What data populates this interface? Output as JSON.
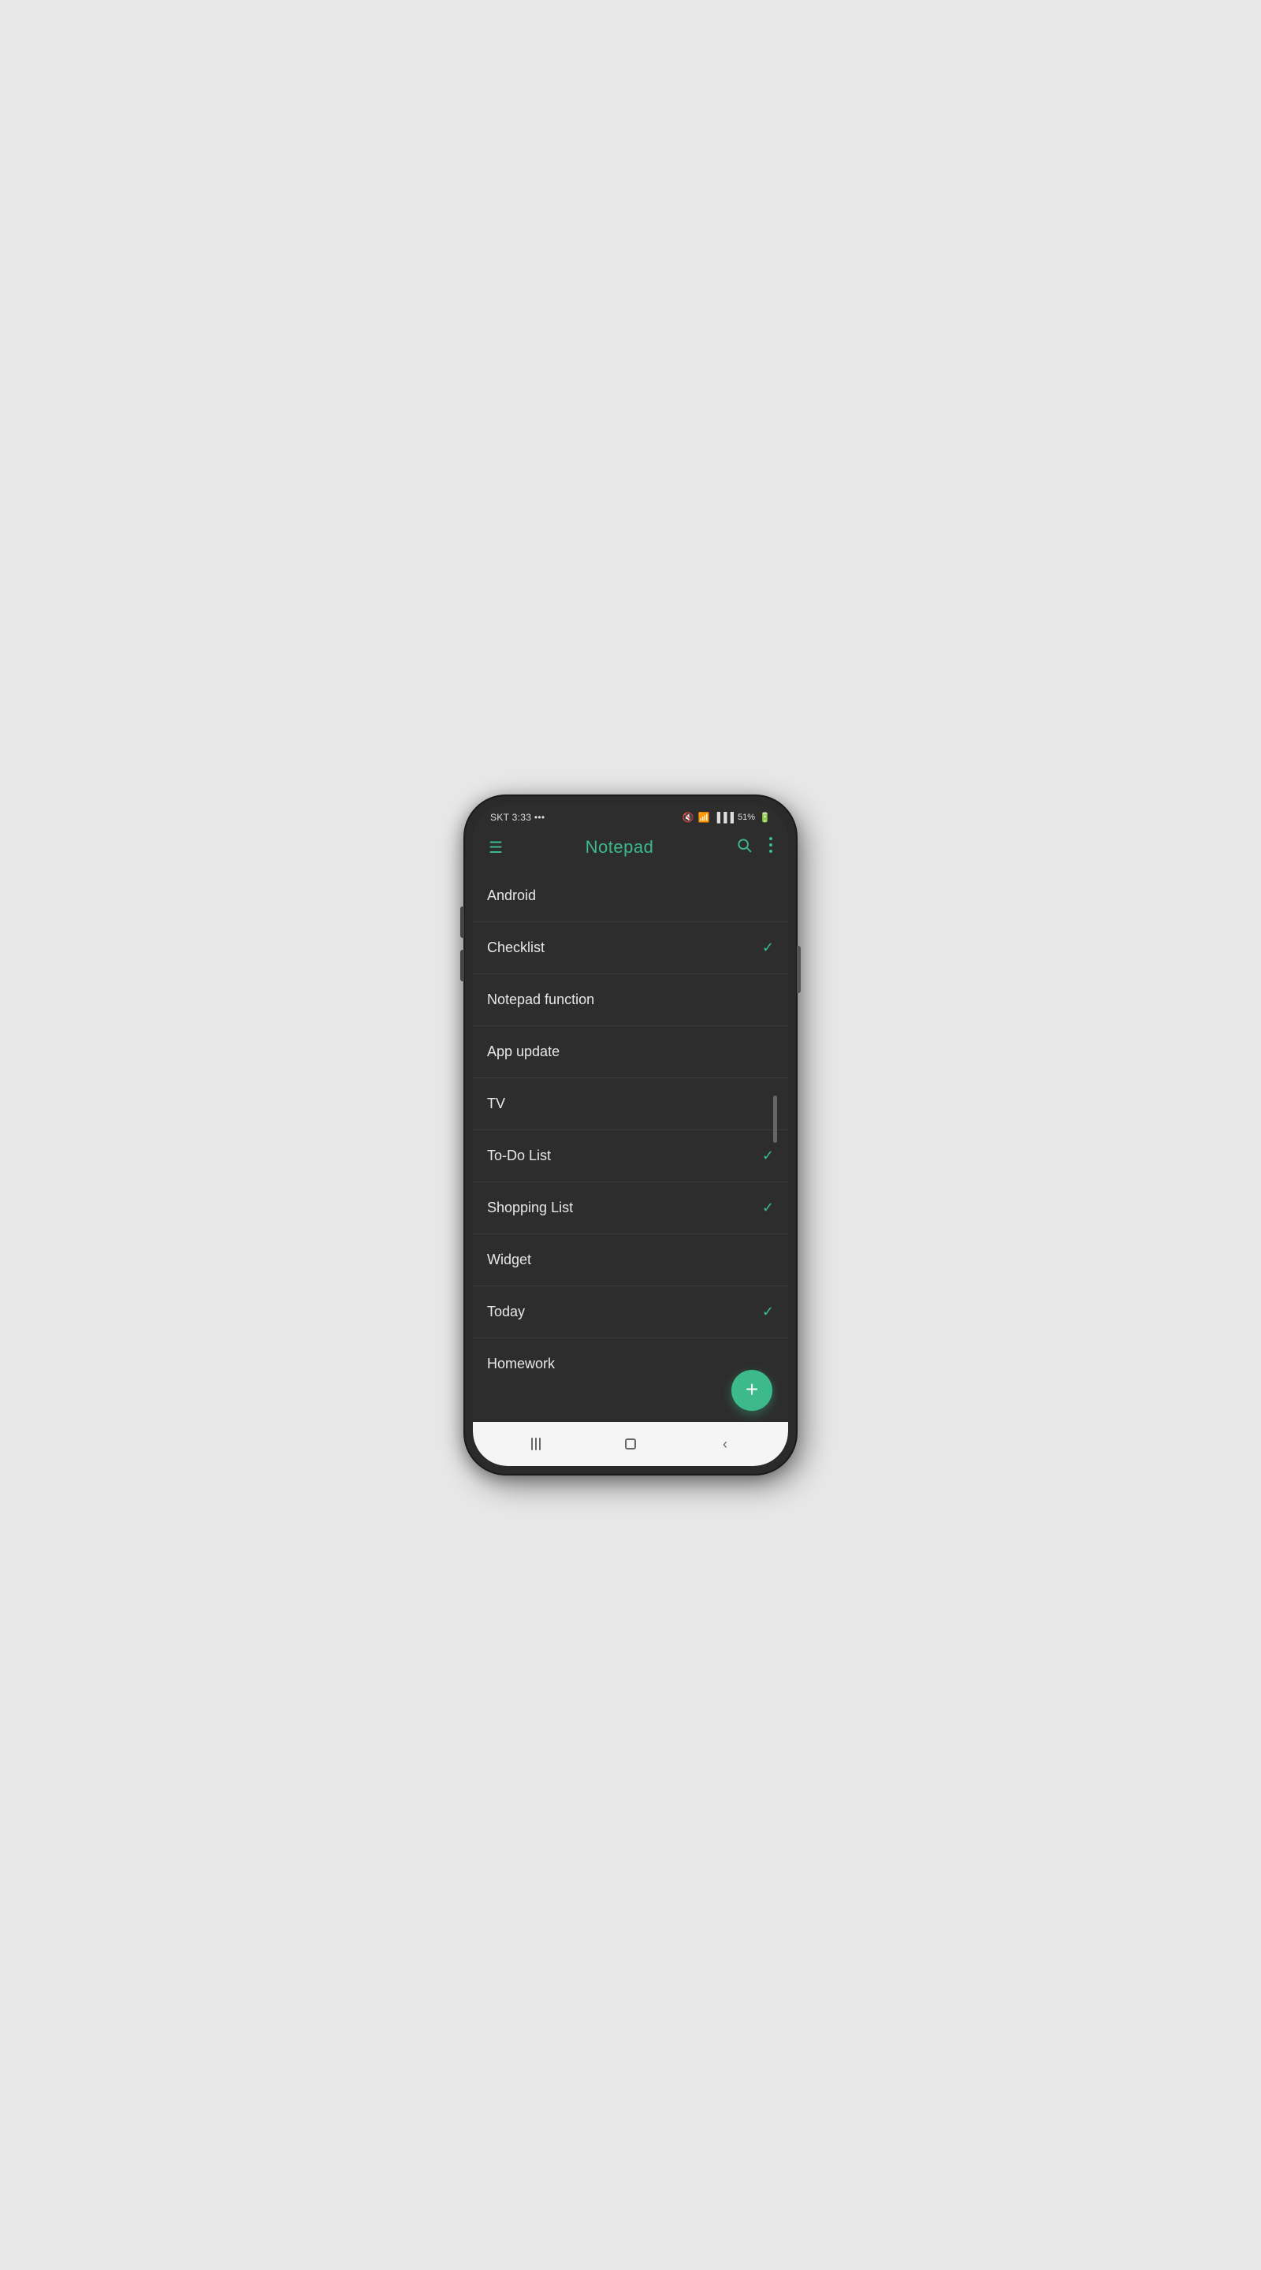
{
  "status": {
    "carrier": "SKT",
    "time": "3:33",
    "dots": "•••",
    "battery": "51%",
    "signal_label": "signal",
    "wifi_label": "wifi",
    "mute_label": "mute",
    "battery_label": "battery"
  },
  "app_bar": {
    "title": "Notepad",
    "menu_icon": "☰",
    "search_icon": "search",
    "more_icon": "more"
  },
  "notes": [
    {
      "title": "Android",
      "checked": false
    },
    {
      "title": "Checklist",
      "checked": true
    },
    {
      "title": "Notepad function",
      "checked": false
    },
    {
      "title": "App update",
      "checked": false
    },
    {
      "title": "TV",
      "checked": false
    },
    {
      "title": "To-Do List",
      "checked": true
    },
    {
      "title": "Shopping List",
      "checked": true
    },
    {
      "title": "Widget",
      "checked": false
    },
    {
      "title": "Today",
      "checked": true
    },
    {
      "title": "Homework",
      "checked": false
    }
  ],
  "fab": {
    "label": "+"
  },
  "nav": {
    "recents_label": "recent apps",
    "home_label": "home",
    "back_label": "back"
  },
  "colors": {
    "accent": "#3dba8c",
    "background": "#2d2d2d",
    "surface": "#333333",
    "text_primary": "#e8e8e8",
    "text_secondary": "#aaaaaa",
    "divider": "#3a3a3a"
  }
}
